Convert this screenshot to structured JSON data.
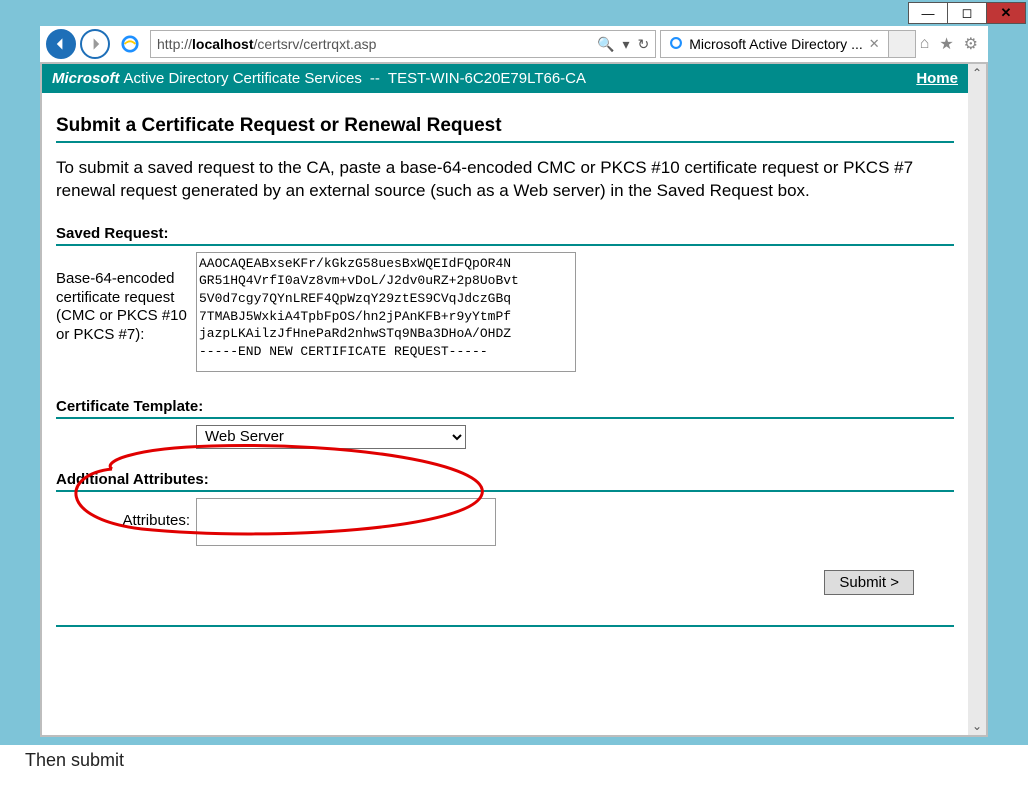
{
  "window": {
    "minimize_glyph": "—",
    "maximize_glyph": "◻",
    "close_glyph": "✕"
  },
  "toolbar": {
    "url_prefix": "http://",
    "url_host": "localhost",
    "url_path": "/certsrv/certrqxt.asp",
    "search_glyph": "🔍",
    "dropdown_glyph": "▾",
    "refresh_glyph": "↻",
    "tab_title": "Microsoft Active Directory ...",
    "tab_close_glyph": "✕",
    "home_glyph": "⌂",
    "star_glyph": "★",
    "gear_glyph": "⚙"
  },
  "banner": {
    "brand": "Microsoft",
    "product": "Active Directory Certificate Services",
    "separator": "--",
    "ca_name": "TEST-WIN-6C20E79LT66-CA",
    "home_link": "Home"
  },
  "page": {
    "title": "Submit a Certificate Request or Renewal Request",
    "instructions": "To submit a saved request to the CA, paste a base-64-encoded CMC or PKCS #10 certificate request or PKCS #7 renewal request generated by an external source (such as a Web server) in the Saved Request box."
  },
  "saved_request": {
    "section_label": "Saved Request:",
    "field_label": "Base-64-encoded certificate request (CMC or PKCS #10 or PKCS #7):",
    "value": "AAOCAQEABxseKFr/kGkzG58uesBxWQEIdFQpOR4N\nGR51HQ4VrfI0aVz8vm+vDoL/J2dv0uRZ+2p8UoBvt\n5V0d7cgy7QYnLREF4QpWzqY29ztES9CVqJdczGBq\n7TMABJ5WxkiA4TpbFpOS/hn2jPAnKFB+r9yYtmPf\njazpLKAilzJfHnePaRd2nhwSTq9NBa3DHoA/OHDZ\n-----END NEW CERTIFICATE REQUEST-----"
  },
  "certificate_template": {
    "section_label": "Certificate Template:",
    "selected": "Web Server",
    "options": [
      "Web Server"
    ]
  },
  "additional_attributes": {
    "section_label": "Additional Attributes:",
    "field_label": "Attributes:",
    "value": ""
  },
  "submit": {
    "label": "Submit >"
  },
  "scrollbar": {
    "up_glyph": "⌃",
    "down_glyph": "⌄"
  },
  "below_window_text": "Then submit"
}
